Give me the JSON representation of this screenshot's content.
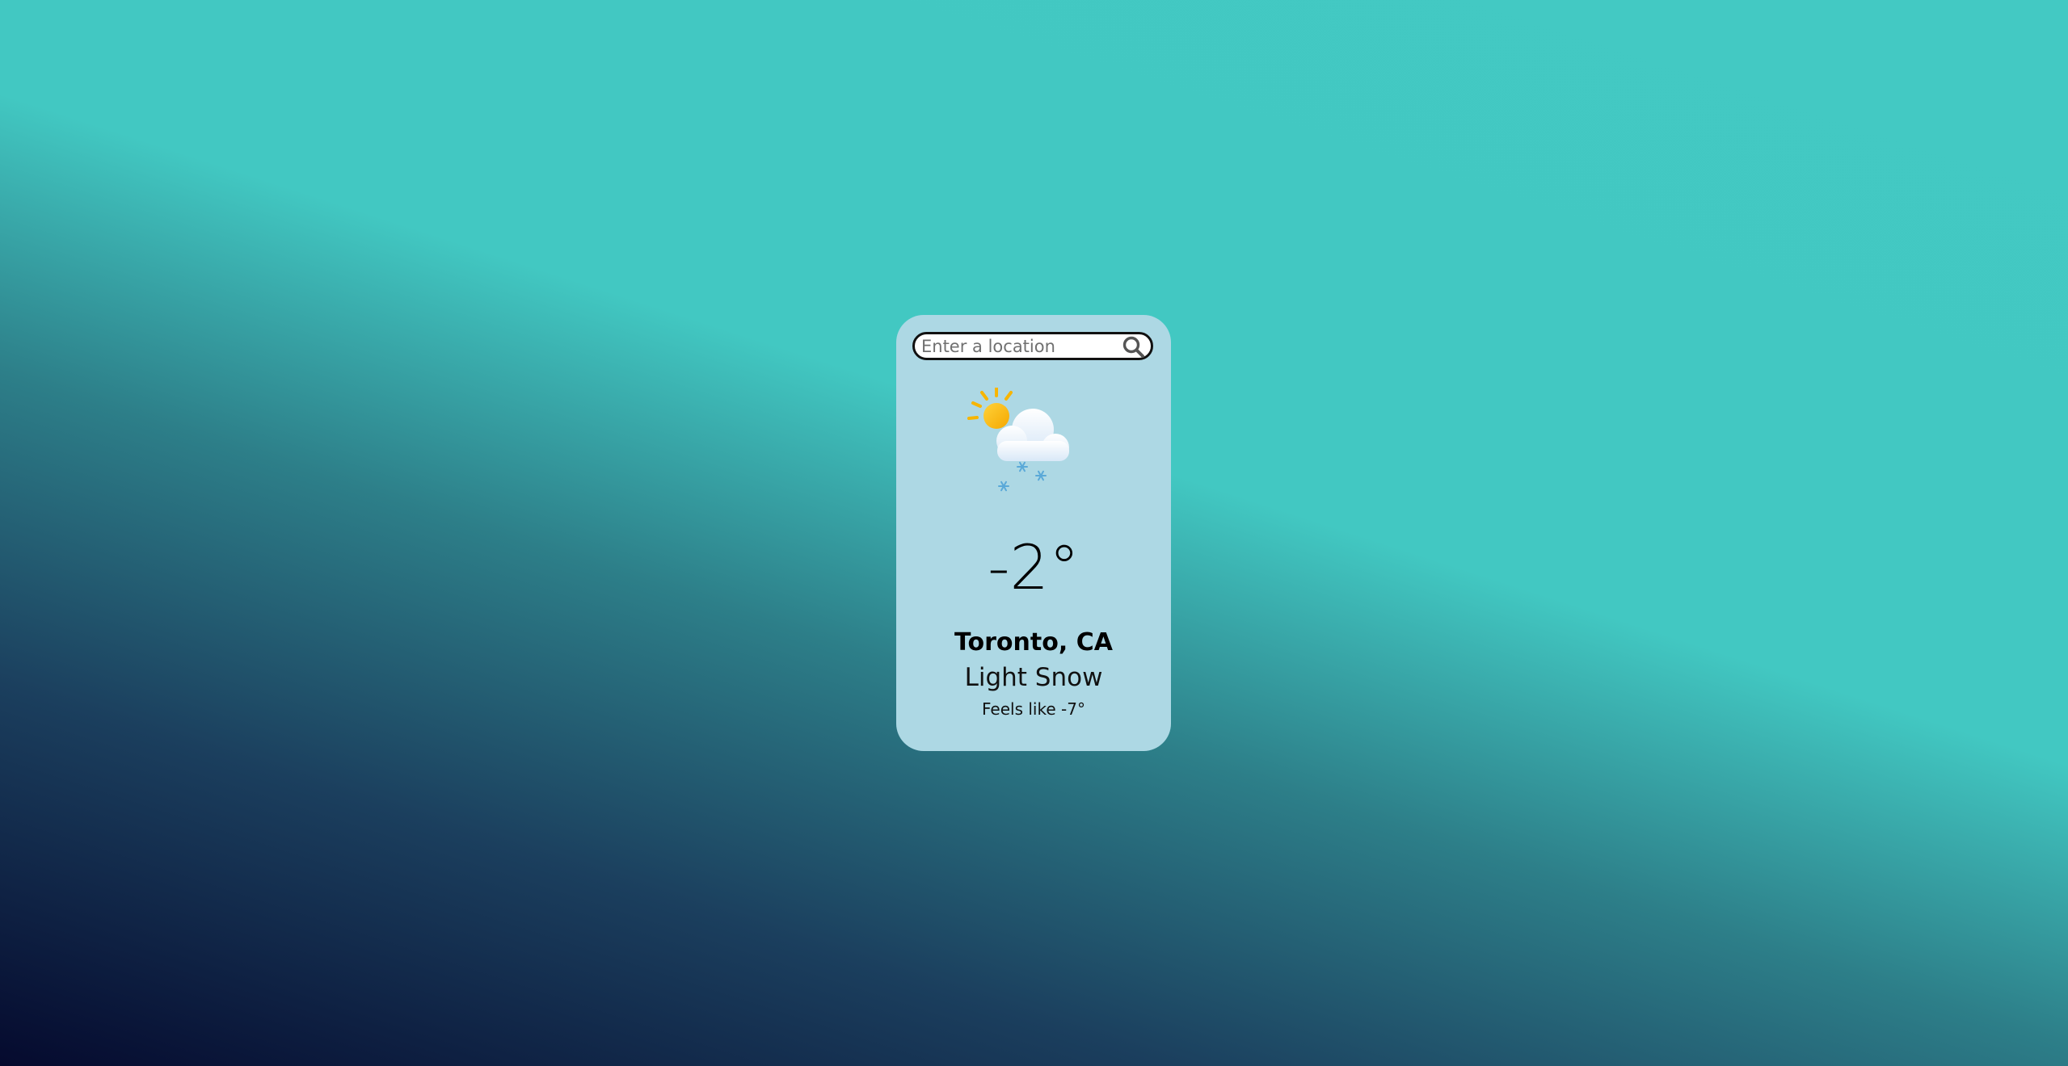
{
  "search": {
    "placeholder": "Enter a location",
    "value": ""
  },
  "weather": {
    "icon": "partly-cloudy-snow-icon",
    "temperature": "-2°",
    "location": "Toronto, CA",
    "condition": "Light Snow",
    "feels_like": "Feels like -7°"
  },
  "colors": {
    "card": "#add8e4",
    "background_top": "#43c9c3",
    "background_bottom": "#050a2e",
    "sun": "#f7b500",
    "snowflake": "#5aa9d8"
  }
}
